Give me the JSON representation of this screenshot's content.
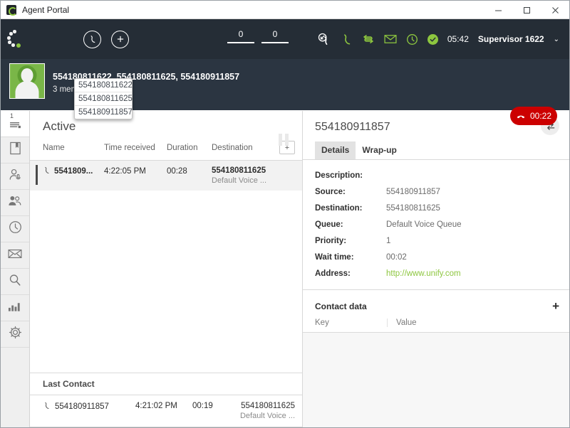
{
  "window": {
    "title": "Agent Portal",
    "minimize": "–",
    "maximize": "□",
    "close": "✕"
  },
  "header": {
    "logo_icon": "unify-dots-logo",
    "phone_button_icon": "phone-handset-icon",
    "add_button_icon": "plus-circle-icon",
    "counters": [
      "0",
      "0"
    ],
    "icons": [
      "incoming-call-icon",
      "phone-handset-icon",
      "transfer-icon",
      "mail-icon",
      "clock-pending-icon"
    ],
    "status_icon": "available-check-icon",
    "time": "05:42",
    "user": "Supervisor 1622",
    "caret": "⌄"
  },
  "callbar": {
    "avatar_icon": "user-avatar",
    "numbers": "554180811622, 554180811625, 554180911857",
    "members_label": "3 members",
    "members_caret": "▲",
    "members_menu": [
      "554180811622",
      "554180811625",
      "554180911857"
    ],
    "pause_icon": "pause-icon",
    "hangup_icon": "hangup-phone-icon",
    "hangup_timer": "00:22"
  },
  "sidebar": {
    "items": [
      {
        "icon": "queue-list-icon",
        "badge": "1",
        "active": true
      },
      {
        "icon": "bookmark-icon",
        "badge": "",
        "active": false
      },
      {
        "icon": "agent-icon",
        "badge": "",
        "active": false
      },
      {
        "icon": "team-icon",
        "badge": "",
        "active": false
      },
      {
        "icon": "history-clock-icon",
        "badge": "",
        "active": false
      },
      {
        "icon": "mail-icon",
        "badge": "",
        "active": false
      },
      {
        "icon": "search-icon",
        "badge": "",
        "active": false
      },
      {
        "icon": "statistics-icon",
        "badge": "",
        "active": false
      },
      {
        "icon": "settings-gear-icon",
        "badge": "",
        "active": false
      }
    ]
  },
  "center": {
    "title": "Active",
    "columns": {
      "name": "Name",
      "time_received": "Time received",
      "duration": "Duration",
      "destination": "Destination",
      "add": "+"
    },
    "rows": [
      {
        "call_icon": "phone-handset-icon",
        "name": "5541809...",
        "time_received": "4:22:05 PM",
        "duration": "00:28",
        "destination": "554180811625",
        "queue": "Default Voice ..."
      }
    ],
    "last_contact": {
      "title": "Last Contact",
      "rows": [
        {
          "call_icon": "phone-handset-icon",
          "name": "554180911857",
          "time_received": "4:21:02 PM",
          "duration": "00:19",
          "destination": "554180811625",
          "queue": "Default Voice ..."
        }
      ]
    }
  },
  "right": {
    "title": "554180911857",
    "swap_icon": "swap-arrows-icon",
    "tabs": [
      {
        "label": "Details",
        "active": true
      },
      {
        "label": "Wrap-up",
        "active": false
      }
    ],
    "details": [
      {
        "key": "Description:",
        "value": "",
        "link": false
      },
      {
        "key": "Source:",
        "value": "554180911857",
        "link": false
      },
      {
        "key": "Destination:",
        "value": "554180811625",
        "link": false
      },
      {
        "key": "Queue:",
        "value": "Default Voice Queue",
        "link": false
      },
      {
        "key": "Priority:",
        "value": "1",
        "link": false
      },
      {
        "key": "Wait time:",
        "value": "00:02",
        "link": false
      },
      {
        "key": "Address:",
        "value": "http://www.unify.com",
        "link": true
      }
    ],
    "contact_data": {
      "title": "Contact data",
      "add_icon": "plus-icon",
      "add_label": "+",
      "columns": {
        "key": "Key",
        "value": "Value"
      },
      "rows": []
    }
  },
  "colors": {
    "header_bg": "#252d36",
    "callbar_bg": "#2b3541",
    "accent_green": "#8dc63f",
    "danger_red": "#cc0000",
    "sidebar_bg": "#efefef"
  }
}
